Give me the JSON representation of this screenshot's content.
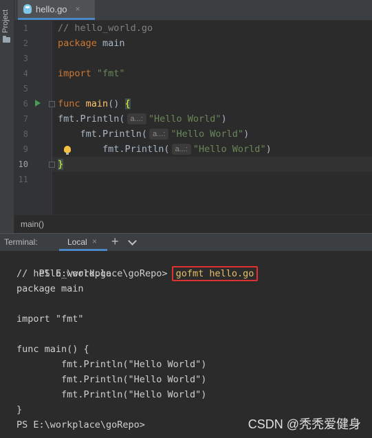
{
  "sidebar": {
    "project_label": "Project"
  },
  "editor_tab": {
    "filename": "hello.go",
    "close": "×"
  },
  "editor": {
    "line_numbers": [
      "1",
      "2",
      "3",
      "4",
      "5",
      "6",
      "7",
      "8",
      "9",
      "10",
      "11"
    ],
    "lines": [
      {
        "segments": [
          {
            "text": "// hello_world.go",
            "cls": "cmt"
          }
        ]
      },
      {
        "segments": [
          {
            "text": "package ",
            "cls": "kw"
          },
          {
            "text": "main",
            "cls": ""
          }
        ]
      },
      {
        "segments": []
      },
      {
        "segments": [
          {
            "text": "import ",
            "cls": "kw"
          },
          {
            "text": "\"fmt\"",
            "cls": "str"
          }
        ]
      },
      {
        "segments": []
      },
      {
        "segments": [
          {
            "text": "func ",
            "cls": "kw"
          },
          {
            "text": "main",
            "cls": "fn"
          },
          {
            "text": "() ",
            "cls": ""
          },
          {
            "text": "{",
            "cls": "brace"
          }
        ]
      },
      {
        "segments": [
          {
            "text": "fmt.Println(",
            "cls": ""
          },
          {
            "hint": "a...:"
          },
          {
            "text": "\"Hello World\"",
            "cls": "str"
          },
          {
            "text": ")",
            "cls": ""
          }
        ]
      },
      {
        "segments": [
          {
            "text": "    fmt.Println(",
            "cls": ""
          },
          {
            "hint": "a...:"
          },
          {
            "text": "\"Hello World\"",
            "cls": "str"
          },
          {
            "text": ")",
            "cls": ""
          }
        ]
      },
      {
        "segments": [
          {
            "text": "        fmt.Println(",
            "cls": ""
          },
          {
            "hint": "a...:"
          },
          {
            "text": "\"Hello World\"",
            "cls": "str"
          },
          {
            "text": ")",
            "cls": ""
          }
        ]
      },
      {
        "segments": [
          {
            "text": "}",
            "cls": "brace"
          }
        ]
      },
      {
        "segments": []
      }
    ]
  },
  "breadcrumb": {
    "label": "main()"
  },
  "terminal_header": {
    "title": "Terminal:",
    "tab_label": "Local",
    "tab_close": "×",
    "add": "+"
  },
  "terminal": {
    "prompt": "PS E:\\workplace\\goRepo>",
    "command": "gofmt hello.go",
    "output": [
      "// hello_world.go",
      "package main",
      "",
      "import \"fmt\"",
      "",
      "func main() {",
      "        fmt.Println(\"Hello World\")",
      "        fmt.Println(\"Hello World\")",
      "        fmt.Println(\"Hello World\")",
      "}"
    ],
    "final_prompt": "PS E:\\workplace\\goRepo>"
  },
  "watermark": "CSDN @秃秃爱健身",
  "colors": {
    "accent": "#4a88c7",
    "highlight_border": "#e03030",
    "keyword": "#cc7832",
    "string": "#6a8759"
  }
}
